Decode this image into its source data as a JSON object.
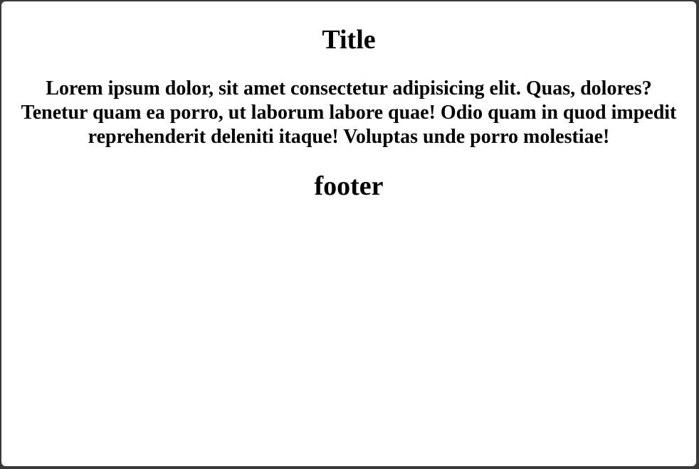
{
  "page": {
    "title": "Title",
    "body": "Lorem ipsum dolor, sit amet consectetur adipisicing elit. Quas, dolores? Tenetur quam ea porro, ut laborum labore quae! Odio quam in quod impedit reprehenderit deleniti itaque! Voluptas unde porro molestiae!",
    "footer": "footer"
  },
  "colors": {
    "background": "#ffffff",
    "text": "#000000",
    "frame": "#3a3a3a"
  }
}
